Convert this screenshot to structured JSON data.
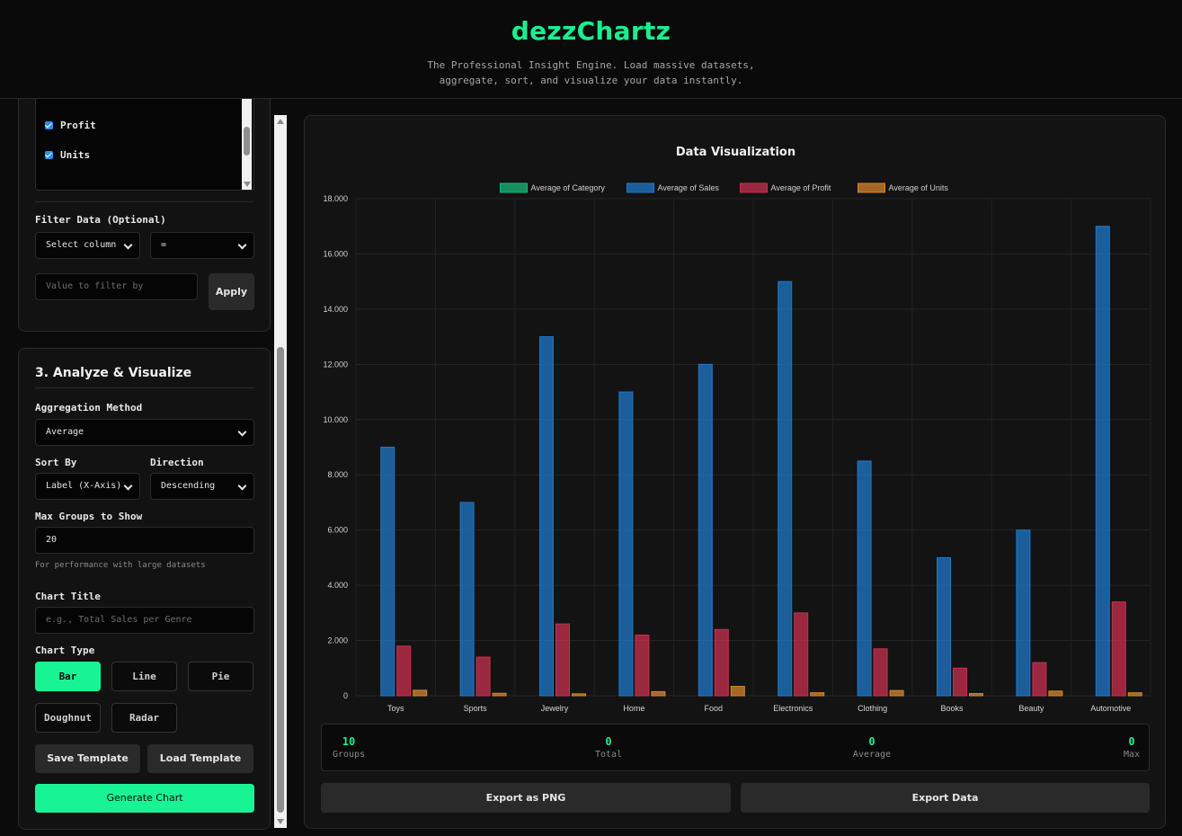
{
  "header": {
    "title": "dezzChartz",
    "tagline_line1": "The Professional Insight Engine. Load massive datasets,",
    "tagline_line2": "aggregate, sort, and visualize your data instantly."
  },
  "sidebar": {
    "columns": [
      {
        "label": "Profit",
        "checked": true
      },
      {
        "label": "Units",
        "checked": true
      }
    ],
    "filter": {
      "title": "Filter Data (Optional)",
      "column_select": "Select column",
      "operator_select": "=",
      "value_placeholder": "Value to filter by",
      "apply_label": "Apply"
    },
    "analyze": {
      "title": "3. Analyze & Visualize",
      "aggregation_label": "Aggregation Method",
      "aggregation_value": "Average",
      "sort_by_label": "Sort By",
      "sort_by_value": "Label (X-Axis)",
      "direction_label": "Direction",
      "direction_value": "Descending",
      "max_groups_label": "Max Groups to Show",
      "max_groups_value": "20",
      "max_groups_hint": "For performance with large datasets",
      "chart_title_label": "Chart Title",
      "chart_title_placeholder": "e.g., Total Sales per Genre",
      "chart_type_label": "Chart Type",
      "chart_types": [
        "Bar",
        "Line",
        "Pie",
        "Doughnut",
        "Radar"
      ],
      "active_chart_type": "Bar",
      "save_template": "Save Template",
      "load_template": "Load Template",
      "generate": "Generate Chart"
    }
  },
  "main": {
    "stats": [
      {
        "value": "10",
        "label": "Groups"
      },
      {
        "value": "0",
        "label": "Total"
      },
      {
        "value": "0",
        "label": "Average"
      },
      {
        "value": "0",
        "label": "Max"
      }
    ],
    "export_png": "Export as PNG",
    "export_data": "Export Data"
  },
  "colors": {
    "accent": "#18f08f",
    "sales": "#1f78c8",
    "profit": "#c8304f",
    "units": "#d6862e",
    "category": "#17b978"
  },
  "chart_data": {
    "type": "bar",
    "title": "Data Visualization",
    "categories": [
      "Toys",
      "Sports",
      "Jewelry",
      "Home",
      "Food",
      "Electronics",
      "Clothing",
      "Books",
      "Beauty",
      "Automotive"
    ],
    "series": [
      {
        "name": "Average of Category",
        "values": [
          0,
          0,
          0,
          0,
          0,
          0,
          0,
          0,
          0,
          0
        ]
      },
      {
        "name": "Average of Sales",
        "values": [
          9000,
          7000,
          13000,
          11000,
          12000,
          15000,
          8500,
          5000,
          6000,
          17000
        ]
      },
      {
        "name": "Average of Profit",
        "values": [
          1800,
          1400,
          2600,
          2200,
          2400,
          3000,
          1700,
          1000,
          1200,
          3400
        ]
      },
      {
        "name": "Average of Units",
        "values": [
          200,
          90,
          70,
          150,
          340,
          110,
          190,
          80,
          170,
          110
        ]
      }
    ],
    "ylim": [
      0,
      18000
    ],
    "yticks": [
      "0",
      "2.000",
      "4.000",
      "6.000",
      "8.000",
      "10.000",
      "12.000",
      "14.000",
      "16.000",
      "18.000"
    ],
    "legend_position": "top",
    "grid": true
  }
}
